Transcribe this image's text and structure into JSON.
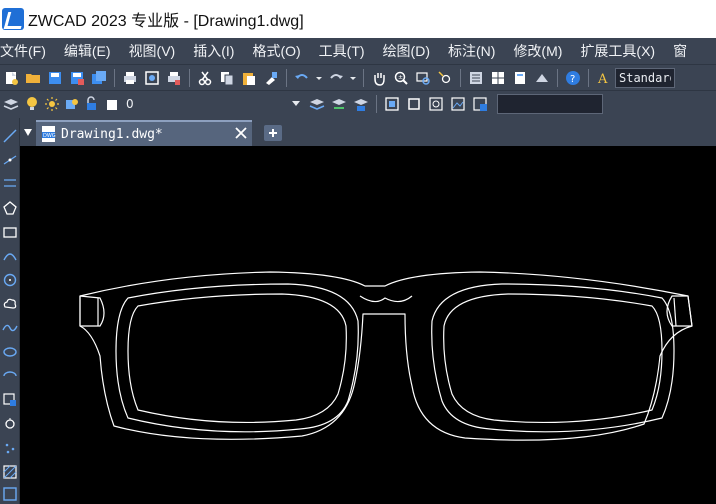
{
  "window": {
    "title": "ZWCAD 2023 专业版 - [Drawing1.dwg]"
  },
  "menubar": {
    "items": [
      "文件(F)",
      "编辑(E)",
      "视图(V)",
      "插入(I)",
      "格式(O)",
      "工具(T)",
      "绘图(D)",
      "标注(N)",
      "修改(M)",
      "扩展工具(X)",
      "窗"
    ]
  },
  "toolbar": {
    "text_style": "Standard"
  },
  "layer_toolbar": {
    "current_layer": "0"
  },
  "tabs": {
    "active": "Drawing1.dwg*"
  },
  "colors": {
    "ui_bg": "#3b4453",
    "canvas_bg": "#000000",
    "accent_blue": "#2f7de1",
    "gold": "#f4c542",
    "drawing_line": "#ffffff"
  }
}
